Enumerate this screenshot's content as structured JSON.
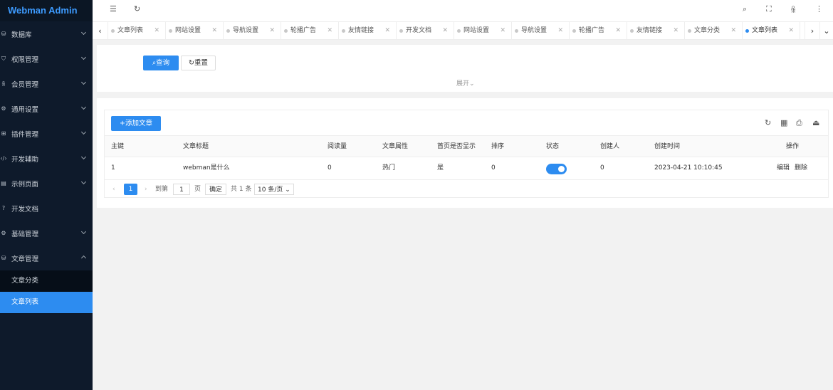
{
  "app_title": "Webman Admin",
  "sidebar": {
    "items": [
      {
        "label": "数据库",
        "icon": "database-icon",
        "glyph": "⛁"
      },
      {
        "label": "权限管理",
        "icon": "shield-icon",
        "glyph": "⛉"
      },
      {
        "label": "会员管理",
        "icon": "user-icon",
        "glyph": "ꆜ"
      },
      {
        "label": "通用设置",
        "icon": "gear-icon",
        "glyph": "⚙"
      },
      {
        "label": "插件管理",
        "icon": "plugin-icon",
        "glyph": "⊞"
      },
      {
        "label": "开发辅助",
        "icon": "code-icon",
        "glyph": "‹/›"
      },
      {
        "label": "示例页面",
        "icon": "layout-icon",
        "glyph": "▤"
      },
      {
        "label": "开发文档",
        "icon": "help-icon",
        "glyph": "?"
      },
      {
        "label": "基础管理",
        "icon": "gear-icon",
        "glyph": "⚙"
      },
      {
        "label": "文章管理",
        "icon": "database-icon",
        "glyph": "⛁"
      }
    ],
    "sub_items": [
      {
        "label": "文章分类"
      },
      {
        "label": "文章列表"
      }
    ]
  },
  "header": {
    "icons": [
      "menu-fold-icon",
      "refresh-icon",
      "search-icon",
      "fullscreen-icon",
      "user-icon",
      "more-icon"
    ]
  },
  "tabs": [
    {
      "label": "文章列表"
    },
    {
      "label": "网站设置"
    },
    {
      "label": "导航设置"
    },
    {
      "label": "轮播广告"
    },
    {
      "label": "友情链接"
    },
    {
      "label": "开发文档"
    },
    {
      "label": "网站设置"
    },
    {
      "label": "导航设置"
    },
    {
      "label": "轮播广告"
    },
    {
      "label": "友情链接"
    },
    {
      "label": "文章分类"
    },
    {
      "label": "文章列表"
    }
  ],
  "search": {
    "query_label": "查询",
    "reset_label": "重置",
    "expand_label": "展开"
  },
  "table": {
    "add_label": "添加文章",
    "columns": [
      "主键",
      "文章标题",
      "阅读量",
      "文章属性",
      "首页是否显示",
      "排序",
      "状态",
      "创建人",
      "创建时间",
      "操作"
    ],
    "rows": [
      {
        "id": "1",
        "title": "webman是什么",
        "views": "0",
        "attribute": "热门",
        "show_home": "是",
        "sort": "0",
        "status_on": true,
        "creator": "0",
        "created_at": "2023-04-21 10:10:45",
        "edit_label": "编辑",
        "delete_label": "删除"
      }
    ]
  },
  "pagination": {
    "current_page": "1",
    "goto_label": "到第",
    "goto_value": "1",
    "page_unit": "页",
    "confirm_label": "确定",
    "total_label": "共 1 条",
    "page_size_label": "10 条/页"
  }
}
